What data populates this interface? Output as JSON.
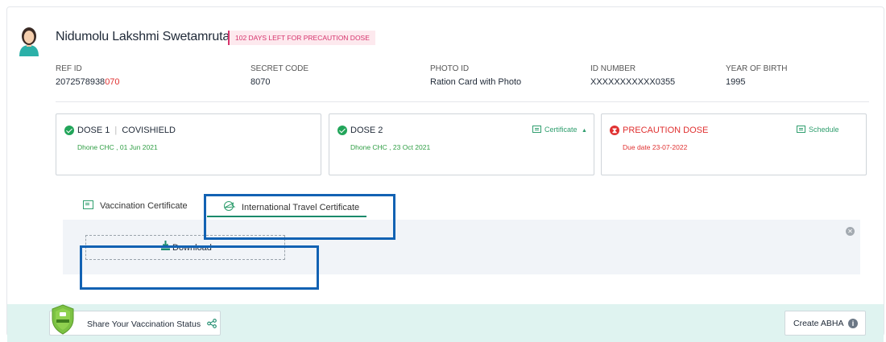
{
  "beneficiary": {
    "name": "Nidumolu Lakshmi Swetamruta",
    "badge": "102 DAYS LEFT FOR PRECAUTION DOSE",
    "ref_id_label": "REF ID",
    "ref_id_prefix": "2072578938",
    "ref_id_suffix": "070",
    "secret_code_label": "SECRET CODE",
    "secret_code": "8070",
    "photo_id_label": "PHOTO ID",
    "photo_id": "Ration Card with Photo",
    "id_number_label": "ID NUMBER",
    "id_number": "XXXXXXXXXXX0355",
    "yob_label": "YEAR OF BIRTH",
    "yob": "1995"
  },
  "doses": [
    {
      "title": "DOSE 1",
      "vaccine": "COVISHIELD",
      "sub": "Dhone CHC , 01 Jun 2021",
      "status": "done"
    },
    {
      "title": "DOSE 2",
      "sub": "Dhone CHC , 23 Oct 2021",
      "link": "Certificate",
      "status": "done"
    },
    {
      "title": "PRECAUTION DOSE",
      "sub": "Due date 23-07-2022",
      "link": "Schedule",
      "status": "due"
    }
  ],
  "tabs": [
    {
      "label": "Vaccination Certificate"
    },
    {
      "label": "International Travel Certificate",
      "active": true
    }
  ],
  "download_label": "Download",
  "footer": {
    "share_label": "Share Your Vaccination Status",
    "abha_label": "Create ABHA"
  },
  "colors": {
    "accent": "#1a8a6b",
    "badge_pink": "#d6336c",
    "success": "#22a55a",
    "danger": "#e03131",
    "highlight": "#1262b3",
    "footer_bg": "#dff3f0"
  }
}
